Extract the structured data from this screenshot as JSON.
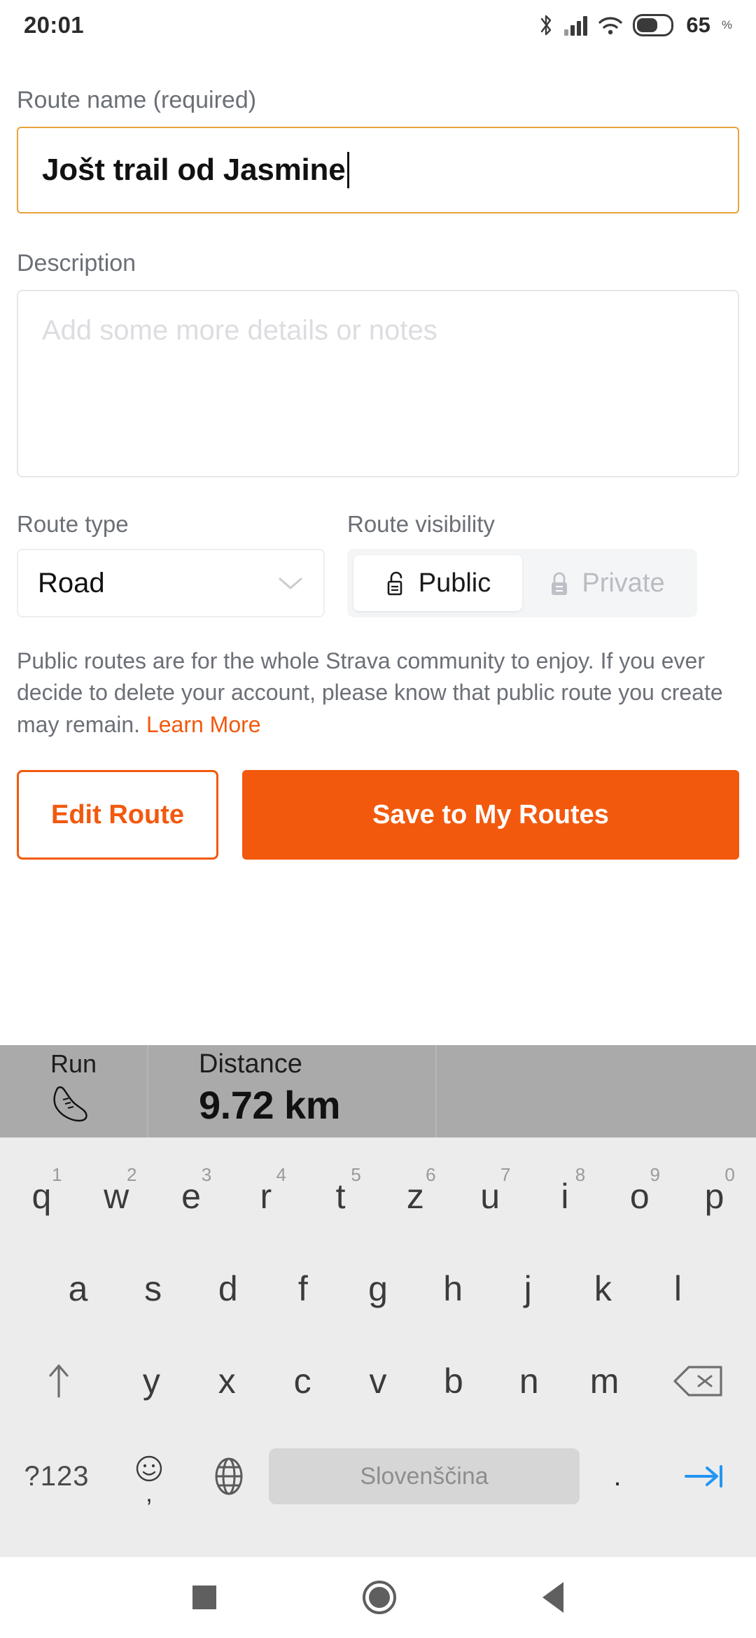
{
  "status_bar": {
    "time": "20:01",
    "battery_level": "65",
    "battery_unit": "%",
    "icons": [
      "bluetooth-icon",
      "cellular-signal-icon",
      "wifi-icon",
      "battery-icon"
    ]
  },
  "form": {
    "name_label": "Route name (required)",
    "name_value": "Jošt trail od Jasmine",
    "description_label": "Description",
    "description_placeholder": "Add some more details or notes",
    "route_type_label": "Route type",
    "route_type_value": "Road",
    "route_visibility_label": "Route visibility",
    "visibility_options": [
      {
        "label": "Public",
        "icon": "unlocked-padlock-icon",
        "selected": true
      },
      {
        "label": "Private",
        "icon": "locked-padlock-icon",
        "selected": false
      }
    ],
    "disclaimer_text": "Public routes are for the whole Strava community to enjoy. If you ever decide to delete your account, please know that public route you create may remain.",
    "learn_more_label": "Learn More",
    "edit_route_label": "Edit Route",
    "save_label": "Save to My Routes"
  },
  "stats": {
    "activity_label": "Run",
    "activity_icon": "running-shoe-icon",
    "distance_label": "Distance",
    "distance_value": "9.72 km"
  },
  "keyboard": {
    "row1": [
      {
        "letter": "q",
        "num": "1"
      },
      {
        "letter": "w",
        "num": "2"
      },
      {
        "letter": "e",
        "num": "3"
      },
      {
        "letter": "r",
        "num": "4"
      },
      {
        "letter": "t",
        "num": "5"
      },
      {
        "letter": "z",
        "num": "6"
      },
      {
        "letter": "u",
        "num": "7"
      },
      {
        "letter": "i",
        "num": "8"
      },
      {
        "letter": "o",
        "num": "9"
      },
      {
        "letter": "p",
        "num": "0"
      }
    ],
    "row2": [
      "a",
      "s",
      "d",
      "f",
      "g",
      "h",
      "j",
      "k",
      "l"
    ],
    "row3": [
      "y",
      "x",
      "c",
      "v",
      "b",
      "n",
      "m"
    ],
    "symbols_key": "?123",
    "comma_key": ",",
    "space_label": "Slovenščina",
    "period_key": ".",
    "shift_icon": "shift-arrow-icon",
    "backspace_icon": "backspace-icon",
    "emoji_icon": "emoji-smiley-icon",
    "globe_icon": "language-globe-icon",
    "enter_icon": "next-field-arrow-icon"
  },
  "navbar": {
    "recents": "recents-square-icon",
    "home": "home-circle-icon",
    "back": "back-triangle-icon"
  },
  "colors": {
    "accent_orange": "#f2590d",
    "focus_border": "#e8a33d",
    "muted_text": "#6b6f76",
    "keyboard_bg": "#ececec"
  }
}
